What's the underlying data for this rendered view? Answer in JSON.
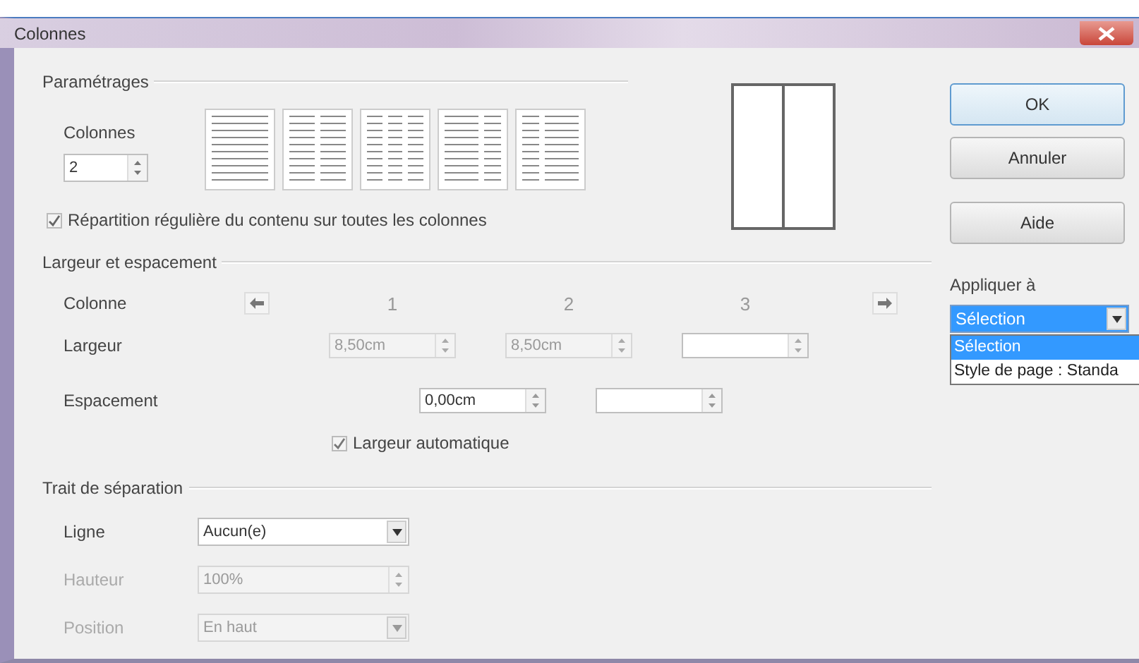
{
  "window": {
    "title": "Colonnes"
  },
  "settings": {
    "title": "Paramétrages",
    "columns_label": "Colonnes",
    "columns_value": "2",
    "even_distribution": {
      "label": "Répartition régulière du contenu sur toutes les colonnes",
      "checked": true
    }
  },
  "width_spacing": {
    "title": "Largeur et espacement",
    "column_label": "Colonne",
    "column_numbers": [
      "1",
      "2",
      "3"
    ],
    "width_label": "Largeur",
    "widths": [
      {
        "value": "8,50cm",
        "disabled": true
      },
      {
        "value": "8,50cm",
        "disabled": true
      },
      {
        "disabled": false
      }
    ],
    "spacing_label": "Espacement",
    "spacings": [
      {
        "value": "0,00cm",
        "disabled": false
      },
      {
        "disabled": false
      }
    ],
    "auto_width": {
      "label": "Largeur automatique",
      "checked": true
    }
  },
  "separator": {
    "title": "Trait de séparation",
    "rows": [
      {
        "kind": "dropdown",
        "label": "Ligne",
        "value": "Aucun(e)",
        "disabled": false
      },
      {
        "kind": "spin",
        "label": "Hauteur",
        "value": "100%",
        "disabled": true
      },
      {
        "kind": "dropdown",
        "label": "Position",
        "value": "En haut",
        "disabled": true
      }
    ]
  },
  "buttons": [
    {
      "label": "OK",
      "default": true
    },
    {
      "label": "Annuler",
      "default": false
    },
    {
      "label": "Aide",
      "default": false
    }
  ],
  "apply_to": {
    "label": "Appliquer à",
    "value": "Sélection",
    "options": [
      {
        "label": "Sélection",
        "selected": true
      },
      {
        "label": "Style de page : Standa",
        "selected": false
      }
    ]
  }
}
